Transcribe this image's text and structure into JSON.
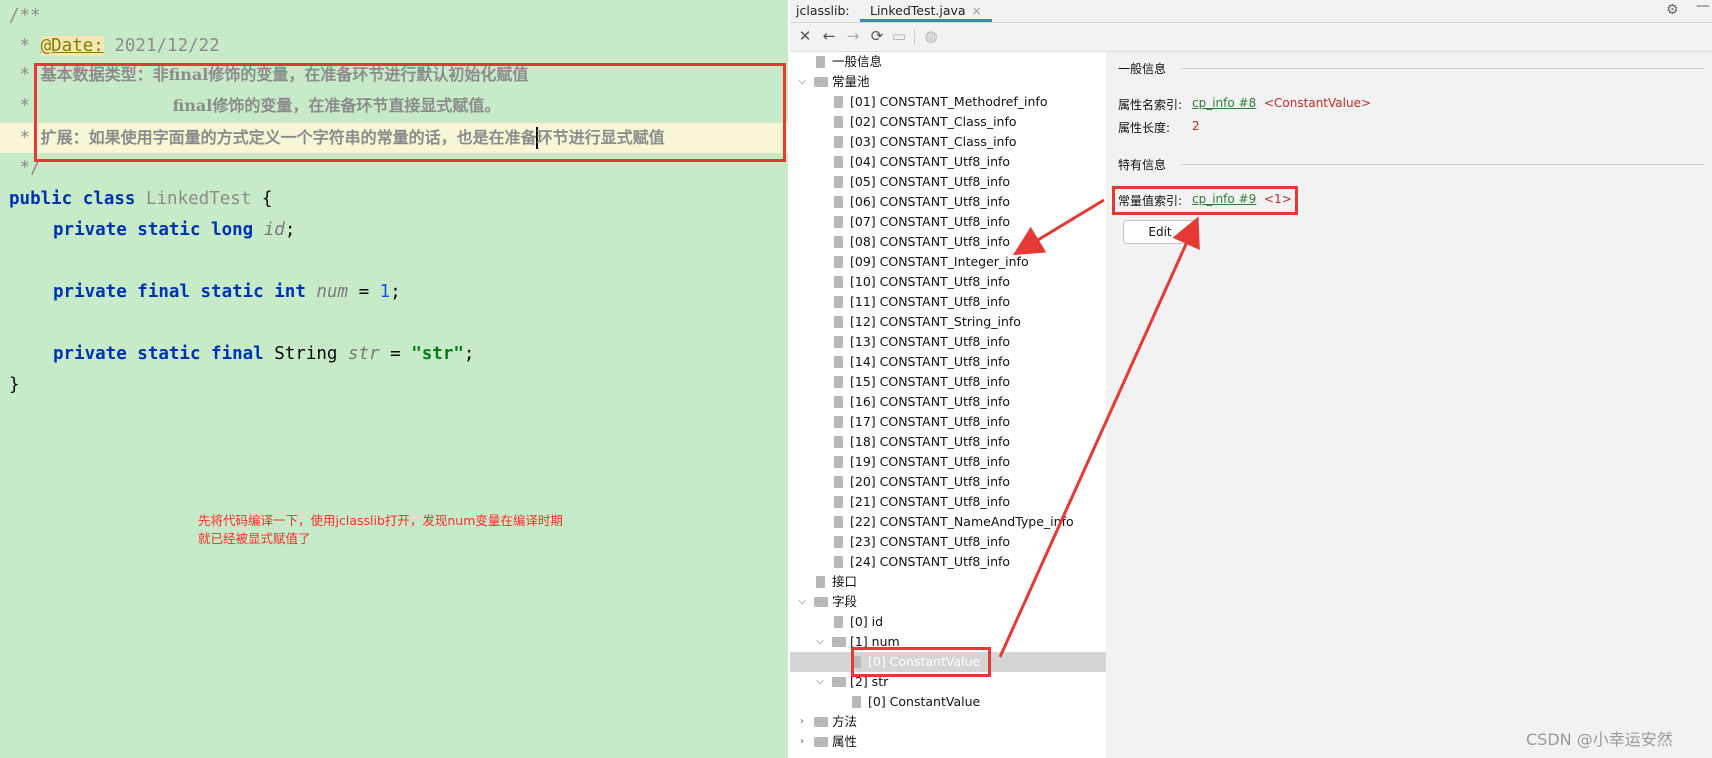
{
  "editor": {
    "lines": {
      "l1": "/**",
      "l2_prefix": " * ",
      "l2_tag": "@Date:",
      "l2_value": " 2021/12/22",
      "l3_prefix": " * ",
      "l3_text": "基本数据类型：非final修饰的变量，在准备环节进行默认初始化赋值",
      "l4_prefix": " * ",
      "l4_text": "final修饰的变量，在准备环节直接显式赋值。",
      "l5_prefix": " * ",
      "l5_text_a": "扩展：如果使用字面量的方式定义一个字符串的常量的话，也是在准备",
      "l5_text_b": "环节进行显式赋值",
      "l6": " */",
      "l7_kw": "public class",
      "l7_name": "LinkedTest",
      "l7_brace": " {",
      "l8_kw": "private static long",
      "l8_field": "id",
      "l8_end": ";",
      "l9_kw": "private final static int",
      "l9_field": "num",
      "l9_eq": " = ",
      "l9_num": "1",
      "l9_end": ";",
      "l10_kw": "private static final",
      "l10_type": " String ",
      "l10_field": "str",
      "l10_eq": " = ",
      "l10_str": "\"str\"",
      "l10_end": ";",
      "l11": "}"
    },
    "annotation": {
      "line1": "先将代码编译一下，使用jclasslib打开，发现num变量在编译时期",
      "line2": "就已经被显式赋值了"
    }
  },
  "tool": {
    "name": "jclasslib:",
    "tab": "LinkedTest.java",
    "tab_close": "×",
    "gear_icon": "gear-icon",
    "minimize_icon": "minimize-icon"
  },
  "toolbar": {
    "close": "✕",
    "back": "←",
    "forward": "→",
    "refresh": "⟳",
    "save": "▭",
    "web": "◍"
  },
  "tree": {
    "general": "一般信息",
    "constant_pool": "常量池",
    "cp": [
      "[01] CONSTANT_Methodref_info",
      "[02] CONSTANT_Class_info",
      "[03] CONSTANT_Class_info",
      "[04] CONSTANT_Utf8_info",
      "[05] CONSTANT_Utf8_info",
      "[06] CONSTANT_Utf8_info",
      "[07] CONSTANT_Utf8_info",
      "[08] CONSTANT_Utf8_info",
      "[09] CONSTANT_Integer_info",
      "[10] CONSTANT_Utf8_info",
      "[11] CONSTANT_Utf8_info",
      "[12] CONSTANT_String_info",
      "[13] CONSTANT_Utf8_info",
      "[14] CONSTANT_Utf8_info",
      "[15] CONSTANT_Utf8_info",
      "[16] CONSTANT_Utf8_info",
      "[17] CONSTANT_Utf8_info",
      "[18] CONSTANT_Utf8_info",
      "[19] CONSTANT_Utf8_info",
      "[20] CONSTANT_Utf8_info",
      "[21] CONSTANT_Utf8_info",
      "[22] CONSTANT_NameAndType_info",
      "[23] CONSTANT_Utf8_info",
      "[24] CONSTANT_Utf8_info"
    ],
    "interfaces": "接口",
    "fields": "字段",
    "field_id": "[0] id",
    "field_num": "[1] num",
    "field_num_cv": "[0] ConstantValue",
    "field_str": "[2] str",
    "field_str_cv": "[0] ConstantValue",
    "methods": "方法",
    "attributes": "属性"
  },
  "detail": {
    "general_title": "一般信息",
    "name_index_label": "属性名索引:",
    "name_index_link": "cp_info #8",
    "name_index_value": "<ConstantValue>",
    "length_label": "属性长度:",
    "length_value": "2",
    "specific_title": "特有信息",
    "cv_index_label": "常量值索引:",
    "cv_index_link": "cp_info #9",
    "cv_index_value": "<1>",
    "edit_button": "Edit"
  },
  "watermark": "CSDN @小幸运安然",
  "colors": {
    "editor_bg": "#c7ebc9",
    "annotation_red": "#e53935",
    "link_green": "#2e7d32",
    "value_red": "#c62828"
  }
}
